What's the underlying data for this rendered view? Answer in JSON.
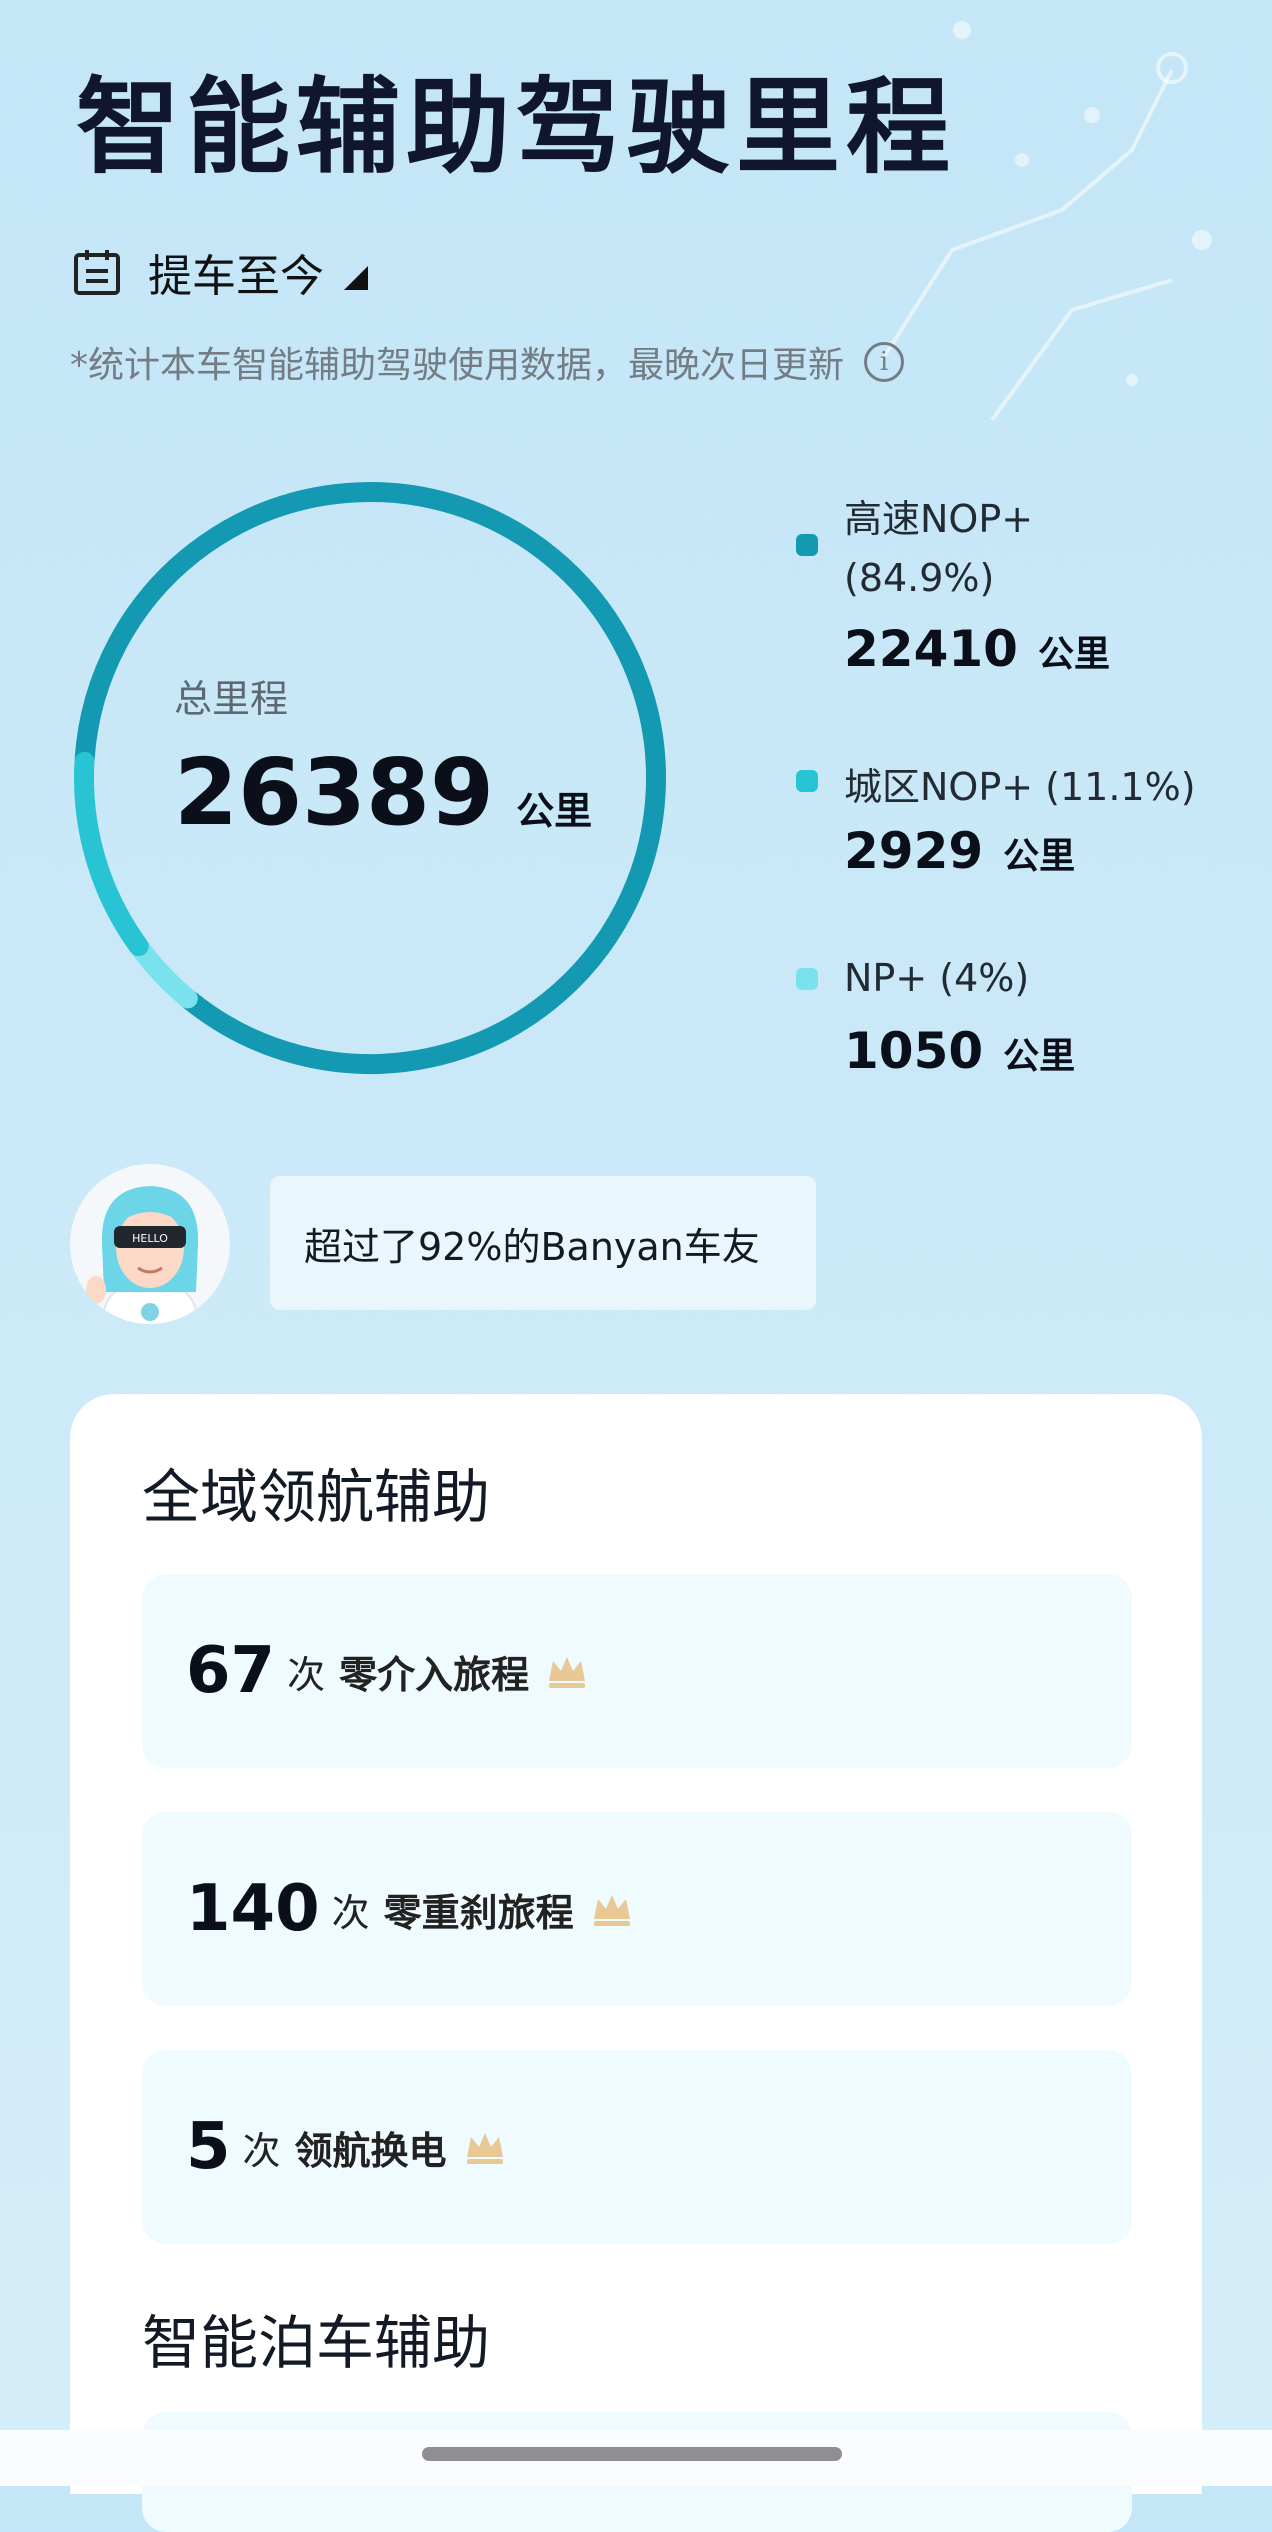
{
  "header": {
    "title": "智能辅助驾驶里程"
  },
  "period": {
    "label": "提车至今"
  },
  "note": {
    "text": "*统计本车智能辅助驾驶使用数据，最晚次日更新",
    "info_icon": "info-icon"
  },
  "total": {
    "label": "总里程",
    "value": "26389",
    "unit": "公里"
  },
  "breakdown": [
    {
      "name_line1": "高速NOP+",
      "name_line2": "(84.9%)",
      "value": "22410",
      "unit": "公里",
      "color": "#1499b2",
      "share": 0.849
    },
    {
      "name_line1": "城区NOP+ (11.1%)",
      "value": "2929",
      "unit": "公里",
      "color": "#29c4d4",
      "share": 0.111
    },
    {
      "name_line1": "NP+ (4%)",
      "value": "1050",
      "unit": "公里",
      "color": "#7ae2ec",
      "share": 0.04
    }
  ],
  "compare": {
    "text": "超过了92%的Banyan车友",
    "avatar_badge": "HELLO"
  },
  "sections": {
    "nav_title": "全域领航辅助",
    "nav_stats": [
      {
        "num": "67",
        "unit": "次",
        "text": "零介入旅程"
      },
      {
        "num": "140",
        "unit": "次",
        "text": "零重刹旅程"
      },
      {
        "num": "5",
        "unit": "次",
        "text": "领航换电"
      }
    ],
    "parking_title": "智能泊车辅助"
  },
  "colors": {
    "accent": "#1499b2",
    "card_bg": "#ffffff",
    "stat_bg": "#effbfe",
    "crown": "#e8c895"
  }
}
